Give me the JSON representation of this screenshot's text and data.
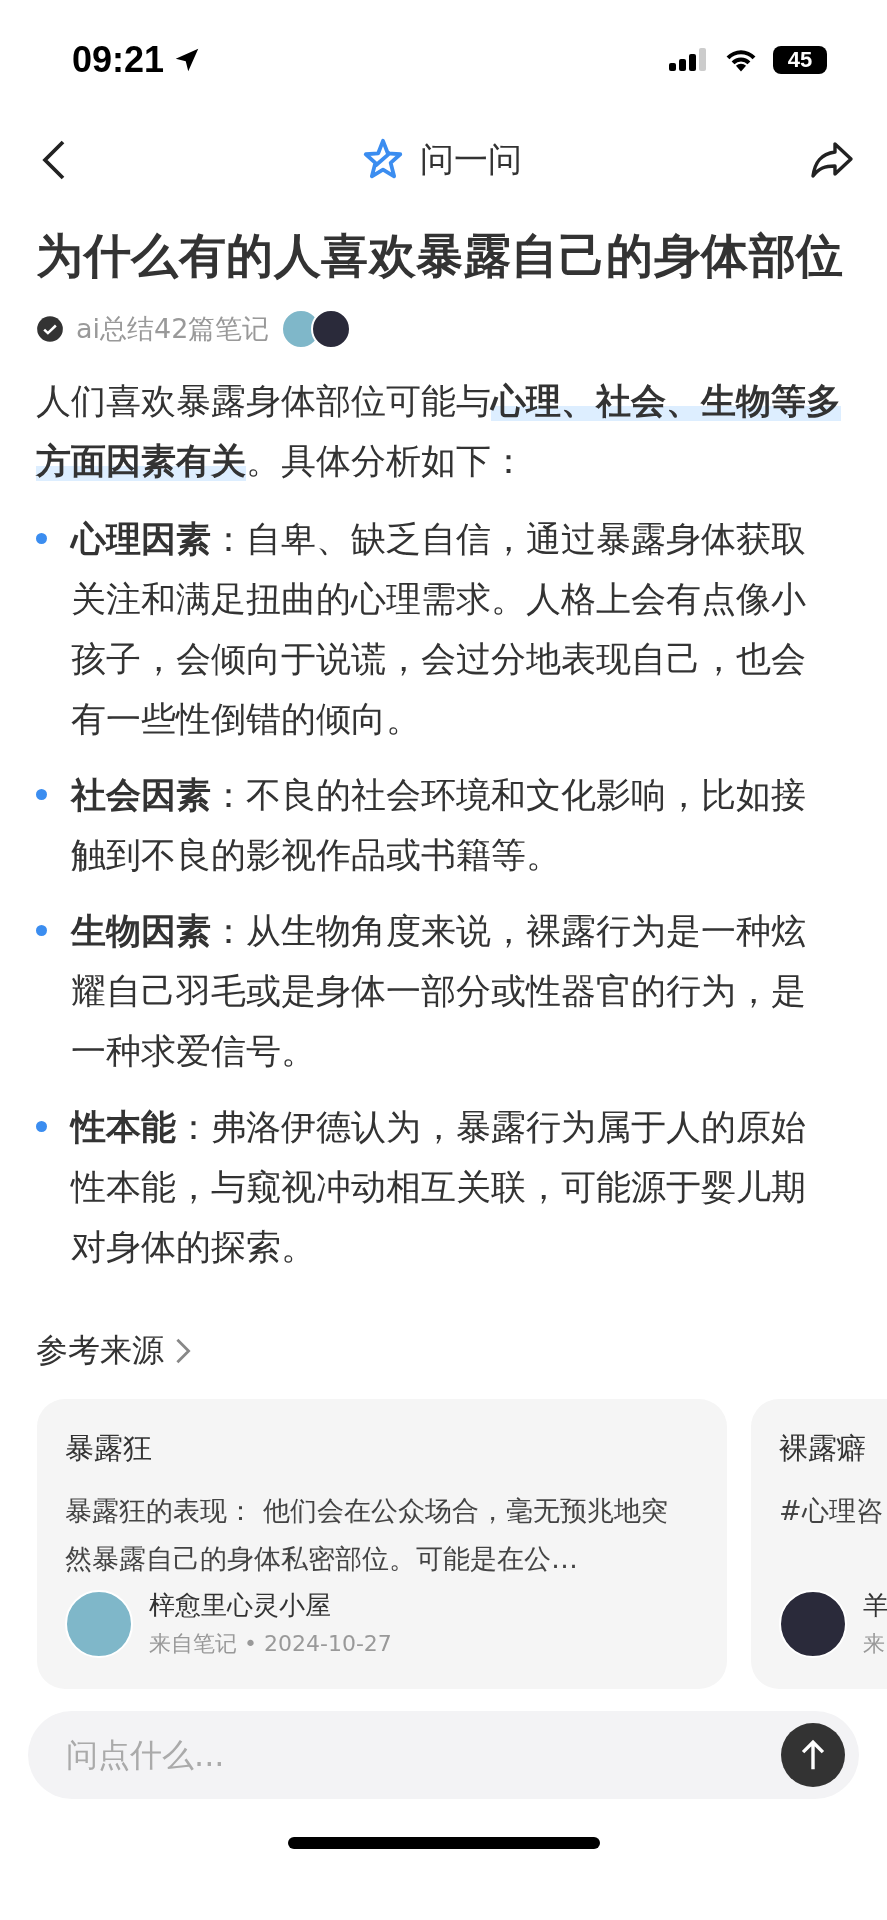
{
  "status_bar": {
    "time": "09:21",
    "battery": "45"
  },
  "header": {
    "title": "问一问"
  },
  "question": "为什么有的人喜欢暴露自己的身体部位",
  "summary": {
    "verified": true,
    "text": "ai总结42篇笔记"
  },
  "answer": {
    "intro": "人们喜欢暴露身体部位可能与**心理、社会、生物等多方面因素有关**。具体分析如下：",
    "bullets": [
      {
        "text": "**心理因素**：自卑、缺乏自信，通过暴露身体获取关注和满足扭曲的心理需求。人格上会有点像小孩子，会倾向于说谎，会过分地表现自己，也会有一些性倒错的倾向。"
      },
      {
        "text": "**社会因素**：不良的社会环境和文化影响，比如接触到不良的影视作品或书籍等。"
      },
      {
        "text": "**生物因素**：从生物角度来说，裸露行为是一种炫耀自己羽毛或是身体一部分或性器官的行为，是一种求爱信号。"
      },
      {
        "text": "**性本能**：弗洛伊德认为，暴露行为属于人的原始性本能，与窥视冲动相互关联，可能源于婴儿期对身体的探索。"
      }
    ]
  },
  "sources": {
    "title": "参考来源",
    "cards": [
      {
        "title": "暴露狂",
        "excerpt": "暴露狂的表现： 他们会在公众场合，毫无预兆地突然暴露自己的身体私密部位。可能是在公…",
        "author": "梓愈里心灵小屋",
        "meta": "来自笔记 • 2024-10-27"
      },
      {
        "title": "裸露癖",
        "excerpt": "#心理咨",
        "author": "羊",
        "meta": "来"
      }
    ]
  },
  "input": {
    "placeholder": "问点什么..."
  }
}
